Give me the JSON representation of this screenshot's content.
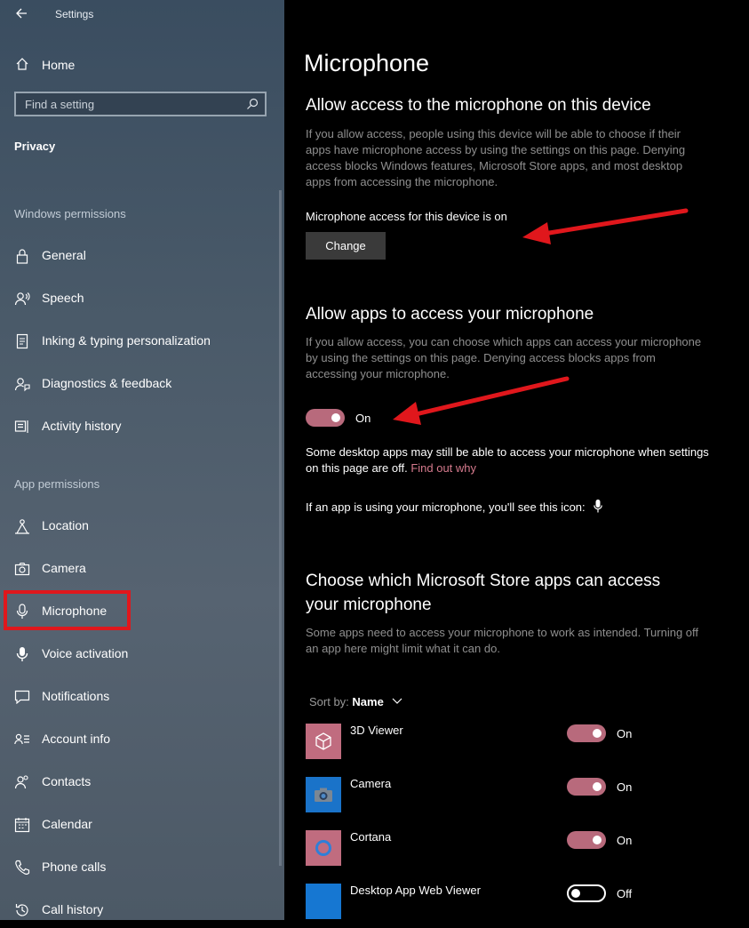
{
  "window": {
    "title": "Settings"
  },
  "sidebar": {
    "home_label": "Home",
    "search_placeholder": "Find a setting",
    "category": "Privacy",
    "windows_permissions_header": "Windows permissions",
    "windows_permissions": [
      {
        "label": "General",
        "icon": "lock-icon"
      },
      {
        "label": "Speech",
        "icon": "speech-icon"
      },
      {
        "label": "Inking & typing personalization",
        "icon": "inking-icon"
      },
      {
        "label": "Diagnostics & feedback",
        "icon": "diagnostics-icon"
      },
      {
        "label": "Activity history",
        "icon": "activity-history-icon"
      }
    ],
    "app_permissions_header": "App permissions",
    "app_permissions": [
      {
        "label": "Location",
        "icon": "location-icon"
      },
      {
        "label": "Camera",
        "icon": "camera-icon"
      },
      {
        "label": "Microphone",
        "icon": "microphone-icon",
        "selected": true
      },
      {
        "label": "Voice activation",
        "icon": "voice-activation-icon"
      },
      {
        "label": "Notifications",
        "icon": "notifications-icon"
      },
      {
        "label": "Account info",
        "icon": "account-info-icon"
      },
      {
        "label": "Contacts",
        "icon": "contacts-icon"
      },
      {
        "label": "Calendar",
        "icon": "calendar-icon"
      },
      {
        "label": "Phone calls",
        "icon": "phone-icon"
      },
      {
        "label": "Call history",
        "icon": "call-history-icon"
      }
    ]
  },
  "main": {
    "title": "Microphone",
    "device_section": {
      "heading": "Allow access to the microphone on this device",
      "description": "If you allow access, people using this device will be able to choose if their apps have microphone access by using the settings on this page. Denying access blocks Windows features, Microsoft Store apps, and most desktop apps from accessing the microphone.",
      "status": "Microphone access for this device is on",
      "change_label": "Change"
    },
    "apps_section": {
      "heading": "Allow apps to access your microphone",
      "description": "If you allow access, you can choose which apps can access your microphone by using the settings on this page. Denying access blocks apps from accessing your microphone.",
      "toggle_label": "On",
      "toggle_on": true,
      "note": "Some desktop apps may still be able to access your microphone when settings on this page are off.",
      "note_link": "Find out why",
      "icon_note": "If an app is using your microphone, you'll see this icon:"
    },
    "store_section": {
      "heading_line1": "Choose which Microsoft Store apps can access",
      "heading_line2": "your microphone",
      "description": "Some apps need to access your microphone to work as intended. Turning off an app here might limit what it can do.",
      "sort_prefix": "Sort by:",
      "sort_value": "Name",
      "apps": [
        {
          "name": "3D Viewer",
          "state": "On",
          "on": true,
          "tile_color": "#c06c7f",
          "icon": "cube-icon"
        },
        {
          "name": "Camera",
          "state": "On",
          "on": true,
          "tile_color": "#1a73c9",
          "icon": "camera-app-icon"
        },
        {
          "name": "Cortana",
          "state": "On",
          "on": true,
          "tile_color": "#c06c7f",
          "icon": "cortana-icon"
        },
        {
          "name": "Desktop App Web Viewer",
          "state": "Off",
          "on": false,
          "tile_color": "#1677d2",
          "icon": "web-viewer-icon"
        }
      ]
    }
  },
  "colors": {
    "accent": "#b86a7c",
    "link": "#d57a8d",
    "annotation_red": "#e0171c"
  }
}
